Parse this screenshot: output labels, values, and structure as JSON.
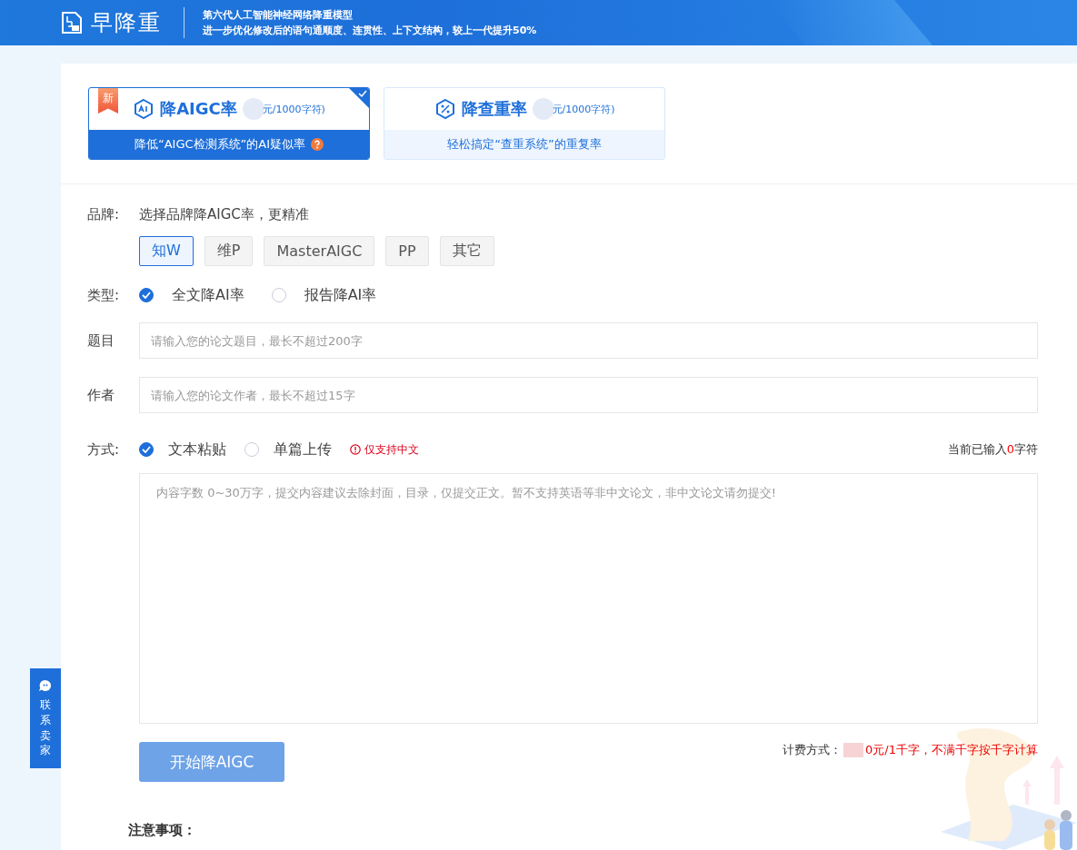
{
  "header": {
    "logo_text": "早降重",
    "headline": "第六代人工智能神经网络降重模型",
    "subline": "进一步优化修改后的语句通顺度、连贯性、上下文结构，较上一代提升50%"
  },
  "services": [
    {
      "kind": "aigc",
      "title": "降AIGC率",
      "price": "元/1000字符)",
      "subtitle": "降低“AIGC检测系统”的AI疑似率",
      "badge": "新",
      "selected": true,
      "help": true
    },
    {
      "kind": "check",
      "title": "降查重率",
      "price": "元/1000字符)",
      "subtitle": "轻松搞定“查重系统”的重复率",
      "selected": false,
      "help": false
    }
  ],
  "brand": {
    "label": "品牌:",
    "hint": "选择品牌降AIGC率，更精准",
    "options": [
      {
        "label": "知W",
        "selected": true
      },
      {
        "label": "维P",
        "selected": false
      },
      {
        "label": "MasterAIGC",
        "selected": false
      },
      {
        "label": "PP",
        "selected": false
      },
      {
        "label": "其它",
        "selected": false
      }
    ]
  },
  "type": {
    "label": "类型:",
    "options": [
      {
        "label": "全文降AI率",
        "selected": true
      },
      {
        "label": "报告降AI率",
        "selected": false
      }
    ]
  },
  "fields": [
    {
      "label": "题目",
      "placeholder": "请输入您的论文题目，最长不超过200字"
    },
    {
      "label": "作者",
      "placeholder": "请输入您的论文作者，最长不超过15字"
    }
  ],
  "mode": {
    "label": "方式:",
    "options": [
      {
        "label": "文本粘贴",
        "selected": true
      },
      {
        "label": "单篇上传",
        "selected": false
      }
    ],
    "note": "仅支持中文",
    "counter_prefix": "当前已输入",
    "counter_value": "0",
    "counter_suffix": "字符"
  },
  "content": {
    "placeholder": "内容字数 0~30万字，提交内容建议去除封面，目录，仅提交正文。暂不支持英语等非中文论文，非中文论文请勿提交!"
  },
  "submit": "开始降AIGC",
  "billing": {
    "label": "计费方式：",
    "text": "0元/1千字，不满千字按千字计算"
  },
  "notes_heading": "注意事项：",
  "contact": "联系卖家"
}
